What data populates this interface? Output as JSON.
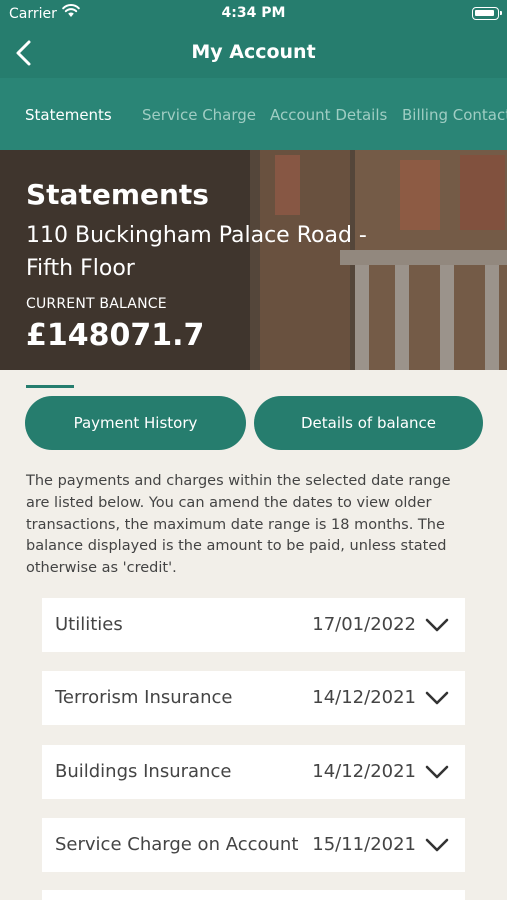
{
  "status_bar": {
    "carrier": "Carrier",
    "time": "4:34 PM"
  },
  "header": {
    "title": "My Account"
  },
  "tabs": [
    {
      "label": "Statements",
      "active": true
    },
    {
      "label": "Service Charge",
      "active": false
    },
    {
      "label": "Account Details",
      "active": false
    },
    {
      "label": "Billing Contact",
      "active": false
    }
  ],
  "hero": {
    "title": "Statements",
    "address": "110 Buckingham Palace Road - Fifth Floor",
    "balance_label": "CURRENT BALANCE",
    "balance": "£148071.7"
  },
  "buttons": {
    "payment_history": "Payment History",
    "details_of_balance": "Details of balance"
  },
  "info_text": "The payments and charges within the selected date range are listed below. You can amend the dates to view older transactions, the maximum date range is 18 months. The balance displayed is the amount to be paid, unless stated otherwise as 'credit'.",
  "items": [
    {
      "label": "Utilities",
      "date": "17/01/2022"
    },
    {
      "label": "Terrorism Insurance",
      "date": "14/12/2021"
    },
    {
      "label": "Buildings Insurance",
      "date": "14/12/2021"
    },
    {
      "label": "Service Charge on Account",
      "date": "15/11/2021"
    }
  ],
  "colors": {
    "primary": "#267d6e",
    "tab_bar": "#2a8576",
    "background": "#f2efe9"
  }
}
